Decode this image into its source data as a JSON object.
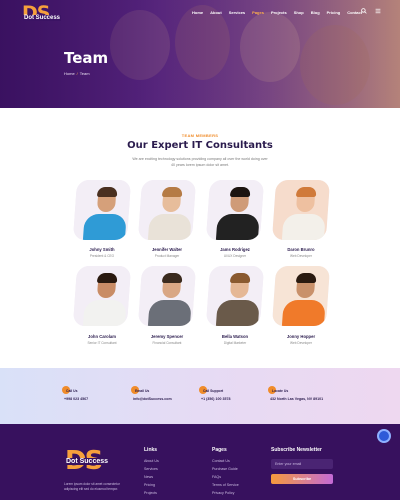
{
  "brand": {
    "mark": "DS",
    "name": "Dot Success"
  },
  "nav": {
    "items": [
      {
        "label": "Home"
      },
      {
        "label": "About"
      },
      {
        "label": "Services"
      },
      {
        "label": "Pages",
        "active": true
      },
      {
        "label": "Projects"
      },
      {
        "label": "Shop"
      },
      {
        "label": "Blog"
      },
      {
        "label": "Pricing"
      },
      {
        "label": "Contact"
      }
    ],
    "icons": [
      "search-icon",
      "menu-icon"
    ]
  },
  "hero": {
    "title": "Team",
    "breadcrumb_home": "Home",
    "breadcrumb_current": "Team"
  },
  "team_section": {
    "eyebrow": "TEAM MEMBERS",
    "title": "Our Expert IT Consultants",
    "description": "We are exciting technology solutions providing company all over the world doing over 40 years lorem ipsum dolor sit amet."
  },
  "members": [
    {
      "name": "Johny Smith",
      "role": "President & CEO"
    },
    {
      "name": "Jennifer Walter",
      "role": "Product Manager"
    },
    {
      "name": "Jams Rodrigez",
      "role": "UI/UX Designer"
    },
    {
      "name": "Daron Brunro",
      "role": "Web Developer"
    },
    {
      "name": "John Carolam",
      "role": "Senior IT Consultant"
    },
    {
      "name": "Jeremy Spencer",
      "role": "Financial Consultant"
    },
    {
      "name": "Bella Watson",
      "role": "Digital Marketer"
    },
    {
      "name": "Jonny Hopper",
      "role": "Web Developer"
    }
  ],
  "contact": [
    {
      "label": "Call Us",
      "value": "+998 023 4567"
    },
    {
      "label": "Email Us",
      "value": "info@dotSuccess.com"
    },
    {
      "label": "Call Support",
      "value": "+1 (356) 100 3578"
    },
    {
      "label": "Locate Us",
      "value": "432 North Las Vegas, NV 89101"
    }
  ],
  "footer": {
    "description": "Lorem ipsum dolor sit amet consectetur adipiscing elit sed do eiusmod tempor.",
    "links_title": "Links",
    "links": [
      "About Us",
      "Services",
      "News",
      "Pricing",
      "Projects"
    ],
    "pages_title": "Pages",
    "pages": [
      "Contact Us",
      "Purchase Guide",
      "FAQs",
      "Terms of Service",
      "Privacy Policy"
    ],
    "newsletter_title": "Subscribe Newsletter",
    "newsletter_placeholder": "Enter your email",
    "newsletter_button": "Subscribe"
  },
  "colors": {
    "brand_purple": "#37115e",
    "accent_orange": "#f08c2a"
  }
}
